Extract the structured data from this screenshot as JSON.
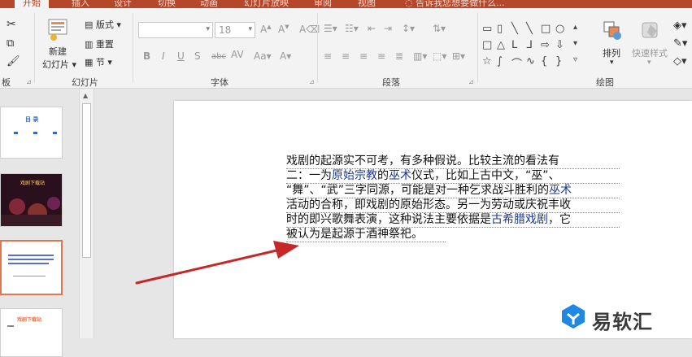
{
  "tabs": [
    {
      "label": "开始",
      "active": true
    },
    {
      "label": "插入"
    },
    {
      "label": "设计"
    },
    {
      "label": "切换"
    },
    {
      "label": "动画"
    },
    {
      "label": "幻灯片放映"
    },
    {
      "label": "审阅"
    },
    {
      "label": "视图"
    }
  ],
  "tell_me": "告诉我您想要做什么...",
  "ribbon": {
    "clipboard_label": "板",
    "new_slide_line1": "新建",
    "new_slide_line2": "幻灯片",
    "layout": "版式",
    "reset": "重置",
    "section": "节",
    "slides_group": "幻灯片",
    "font_size": "18",
    "font_group": "字体",
    "paragraph_group": "段落",
    "drawing_group": "绘图",
    "arrange": "排列",
    "quick_styles": "快速样式"
  },
  "thumbnails": {
    "t1_title": "目 录",
    "t2_title": "戏剧下载站",
    "t4_title": "戏剧下载站"
  },
  "slide_text": {
    "l1": "戏剧的起源实不可考，有多种假说。比较主流的看法有",
    "l2a": "二：一为",
    "l2b": "原始宗教",
    "l2c": "的",
    "l2d": "巫术",
    "l2e": "仪式，比如上古中文，“巫”、",
    "l3a": "“舞”、“武”三字同源，可能是对一种乞求战斗胜利的",
    "l3b": "巫术",
    "l4": "活动的合称，即戏剧的原始形态。另一为劳动或庆祝丰收",
    "l5a": "时的即兴歌舞表演，这种说法主要依据是",
    "l5b": "古希腊戏剧",
    "l5c": "，它",
    "l6": "被认为是起源于酒神祭祀。"
  },
  "watermark": "易软汇",
  "colors": {
    "accent": "#b7472a",
    "link": "#1e3a8a",
    "arrow": "#d32f2f"
  }
}
